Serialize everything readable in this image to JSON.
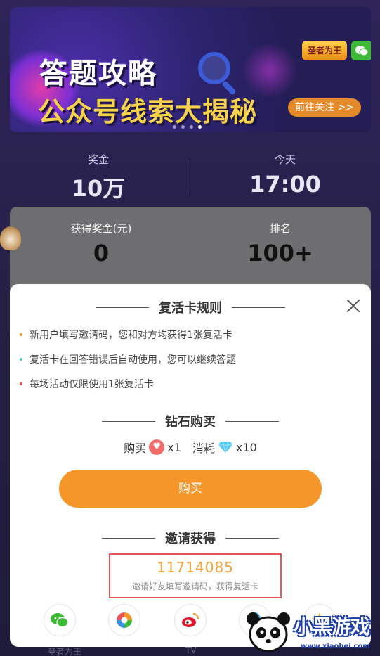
{
  "banner": {
    "title_line1": "答题攻略",
    "title_line2": "公众号线索大揭秘",
    "follow_link": "前往关注 >>",
    "logo_text": "圣者为王",
    "page_indicator": {
      "count": 4,
      "active": 3
    }
  },
  "stats": {
    "prize_label": "奖金",
    "prize_value": "10万",
    "time_label": "今天",
    "time_value": "17:00"
  },
  "my_stats": {
    "earned_label": "获得奖金(元)",
    "earned_value": "0",
    "rank_label": "排名",
    "rank_value": "100+"
  },
  "modal": {
    "rules_title": "复活卡规则",
    "rules": [
      {
        "text": "新用户填写邀请码，您和对方均获得1张复活卡",
        "color": "#f5962b"
      },
      {
        "text": "复活卡在回答错误后自动使用，您可以继续答题",
        "color": "#3fc4a8"
      },
      {
        "text": "每场活动仅限使用1张复活卡",
        "color": "#e85454"
      }
    ],
    "diamond_title": "钻石购买",
    "buy_prefix": "购买",
    "buy_qty": "x1",
    "cost_prefix": "消耗",
    "cost_qty": "x10",
    "buy_button": "购买",
    "invite_title": "邀请获得",
    "invite_code": "11714085",
    "invite_hint": "邀请好友填写邀请码，获得复活卡"
  },
  "share_targets": [
    "wechat-icon",
    "moments-icon",
    "weibo-icon",
    "qq-icon",
    "qzone-icon"
  ],
  "footer": {
    "left_label": "圣者为王",
    "mid_label": "TV"
  },
  "watermark": {
    "brand": "小黑游戏",
    "url": "www.xiaohei.com"
  },
  "colors": {
    "accent": "#f5962b",
    "invite_code": "#f1a23a",
    "highlight_box": "#e85454",
    "background": "#2b2150"
  }
}
